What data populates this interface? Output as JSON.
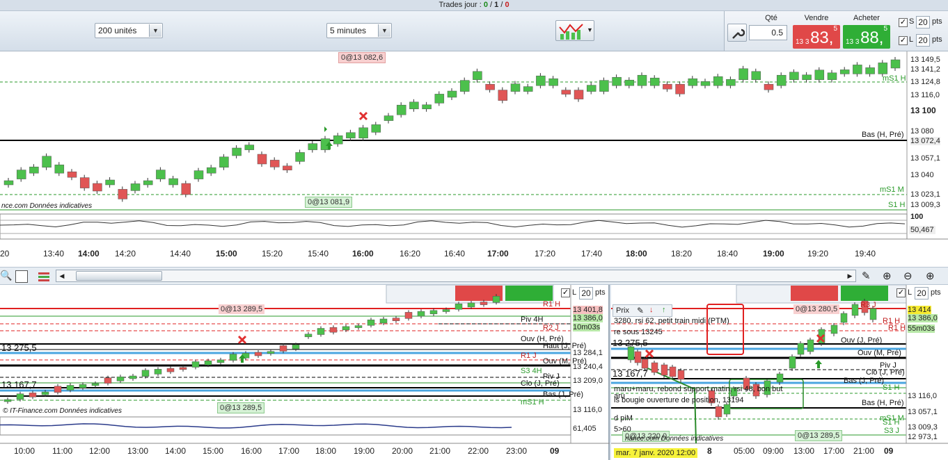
{
  "topbar": {
    "label": "Trades jour : ",
    "v1": "0",
    "sep1": " / ",
    "v2": "1",
    "sep2": " / ",
    "v3": "0"
  },
  "toolbar": {
    "units": "200 unités",
    "interval": "5 minutes"
  },
  "order": {
    "qty_label": "Qté",
    "qty_value": "0.5",
    "sell_label": "Vendre",
    "buy_label": "Acheter",
    "sell_small": "13 3",
    "sell_big": "83,",
    "sell_sup": "5",
    "buy_small": "13 3",
    "buy_big": "88,",
    "buy_sup": "5",
    "s_label": "S",
    "l_label": "L",
    "pts1": "20",
    "pts2": "20",
    "pts_unit": "pts"
  },
  "main": {
    "order_tag_top": "0@13 082,6",
    "order_tag_bottom": "0@13 081,9",
    "watermark": "nce.com  Données indicatives",
    "bas_label": "Bas (H, Pré)",
    "ms1h_label": "mS1 H",
    "ms1m_label": "mS1 M",
    "s1h_label": "S1 H",
    "price_labels": [
      "13 149,5",
      "13 141,2",
      "13 124,8",
      "13 116,0",
      "13 100",
      "13 080",
      "13 072,4",
      "13 057,1",
      "13 040",
      "13 023,1",
      "13 009,3"
    ],
    "osc_labels": [
      "100",
      "50,467"
    ],
    "time_labels": [
      "20",
      "13:40",
      "14:00",
      "14:20",
      "14:40",
      "15:00",
      "15:20",
      "15:40",
      "16:00",
      "16:20",
      "16:40",
      "17:00",
      "17:20",
      "17:40",
      "18:00",
      "18:20",
      "18:40",
      "19:00",
      "19:20",
      "19:40"
    ],
    "candles": [
      [
        1,
        0
      ],
      [
        1,
        1
      ],
      [
        1,
        2
      ],
      [
        1,
        3
      ],
      [
        1,
        2
      ],
      [
        0,
        2
      ],
      [
        0,
        1
      ],
      [
        0,
        0
      ],
      [
        1,
        0
      ],
      [
        0,
        -1
      ],
      [
        1,
        -1
      ],
      [
        1,
        0
      ],
      [
        1,
        1
      ],
      [
        1,
        0
      ],
      [
        0,
        0
      ],
      [
        1,
        1
      ],
      [
        1,
        2
      ],
      [
        1,
        3
      ],
      [
        1,
        5
      ],
      [
        1,
        6
      ],
      [
        0,
        5
      ],
      [
        0,
        4
      ],
      [
        0,
        3
      ],
      [
        1,
        4
      ],
      [
        1,
        6
      ],
      [
        1,
        6
      ],
      [
        1,
        7
      ],
      [
        1,
        8
      ],
      [
        1,
        8
      ],
      [
        1,
        9
      ],
      [
        1,
        11
      ],
      [
        1,
        12
      ],
      [
        1,
        13
      ],
      [
        1,
        13
      ],
      [
        1,
        14
      ],
      [
        1,
        15
      ],
      [
        1,
        16
      ],
      [
        1,
        18
      ],
      [
        0,
        17
      ],
      [
        0,
        16
      ],
      [
        1,
        16
      ],
      [
        1,
        16
      ],
      [
        1,
        17
      ],
      [
        1,
        17
      ],
      [
        0,
        16
      ],
      [
        0,
        16
      ],
      [
        1,
        16
      ],
      [
        1,
        16
      ],
      [
        1,
        17
      ],
      [
        1,
        17
      ],
      [
        1,
        17
      ],
      [
        1,
        17
      ],
      [
        0,
        17
      ],
      [
        0,
        17
      ],
      [
        1,
        17
      ],
      [
        1,
        17
      ],
      [
        1,
        17
      ],
      [
        1,
        17
      ],
      [
        1,
        18
      ],
      [
        1,
        18
      ],
      [
        0,
        17
      ],
      [
        1,
        17
      ],
      [
        1,
        18
      ],
      [
        1,
        18
      ],
      [
        1,
        18
      ],
      [
        1,
        18
      ],
      [
        1,
        19
      ],
      [
        1,
        19
      ],
      [
        1,
        19
      ],
      [
        1,
        19
      ],
      [
        1,
        20
      ]
    ]
  },
  "subleft": {
    "order_tag_top": "0@13 289,5",
    "order_tag_bottom": "0@13 289,5",
    "watermark": "© IT-Finance.com  Données indicatives",
    "level_labels": [
      "13 275,5",
      "13 167,7"
    ],
    "right_labels": [
      "R1 H",
      "Piv 4H",
      "R2 J",
      "Ouv (H, Pré)",
      "Haut (J, Pré)",
      "R1 J",
      "Ouv (M, Pré)",
      "S3 4H",
      "Piv J",
      "Clo (J, Pré)",
      "Bas (J, Pré)",
      "mS1 H"
    ],
    "price_labels": [
      "13 401,8",
      "13 386,0",
      "10m03s",
      "13 284,1",
      "13 240,4",
      "13 209,0",
      "13 116,0"
    ],
    "osc_label": "61,405",
    "time_labels": [
      "10:00",
      "11:00",
      "12:00",
      "13:00",
      "14:00",
      "15:00",
      "16:00",
      "17:00",
      "18:00",
      "19:00",
      "20:00",
      "21:00",
      "22:00",
      "23:00",
      "09"
    ],
    "mini_l": "L",
    "mini_pts": "20",
    "mini_unit": "pts"
  },
  "subright": {
    "prix_label": "Prix",
    "order_tag_top": "0@13 280,5",
    "order_tag_bottom": "0@13 289,5",
    "order_tag_left": "0@13 220,0",
    "level_labels": [
      "13 275,5",
      "13 167,7"
    ],
    "note_lines": [
      "3280, rsi 62, petit train midi (PTM)",
      "re sous 13245",
      "maru+maru, rebond support matin, rsi 48, bon but",
      "aru",
      "is bougie ouverture de position, 13194",
      "d piM",
      "5>60"
    ],
    "watermark": "nance.com  Données indicatives",
    "right_labels": [
      "R3 J",
      "R1 H",
      "R1 H",
      "Ouv (J, Pré)",
      "Ouv (M, Pré)",
      "Piv J",
      "Clo (J, Pré)",
      "Bas (J, Pré)",
      "S1 H",
      "Bas (H, Pré)",
      "mS1 M",
      "S1 H",
      "S3 J"
    ],
    "price_labels": [
      "13 414",
      "13 386,0",
      "55m03s",
      "13 116,0",
      "13 057,1",
      "13 009,3",
      "12 973,1"
    ],
    "time_labels": [
      "8",
      "05:00",
      "09:00",
      "13:00",
      "17:00",
      "21:00",
      "09"
    ],
    "date_label": "mar. 7 janv. 2020 12:00",
    "mini_l": "L",
    "mini_pts": "20",
    "mini_unit": "pts"
  },
  "colors": {
    "bull": "#4cc04c",
    "bear": "#e05656",
    "sell": "#e04848",
    "buy": "#2fae36"
  }
}
